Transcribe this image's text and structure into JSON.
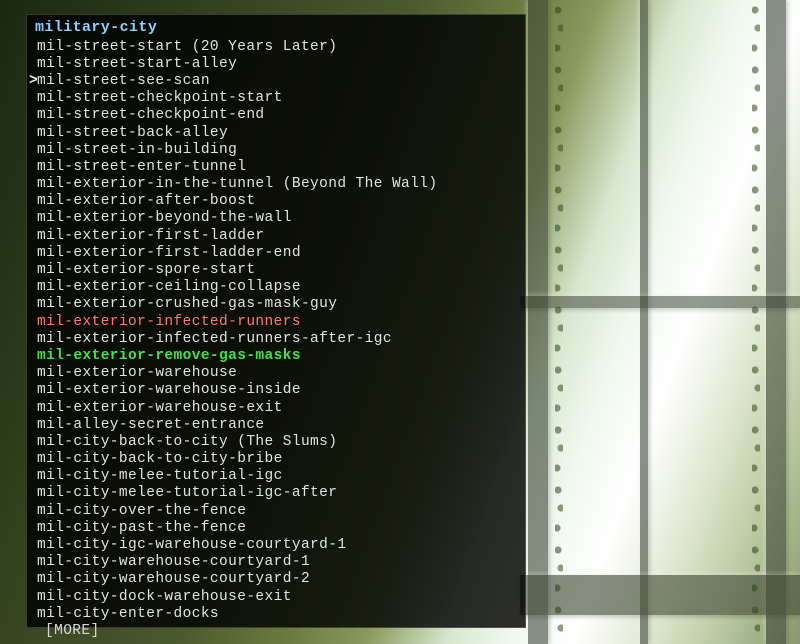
{
  "menu": {
    "title": "military-city",
    "items": [
      {
        "label": "mil-street-start (20 Years Later)",
        "color": "default",
        "selected": false
      },
      {
        "label": "mil-street-start-alley",
        "color": "default",
        "selected": false
      },
      {
        "label": "mil-street-see-scan",
        "color": "default",
        "selected": true
      },
      {
        "label": "mil-street-checkpoint-start",
        "color": "default",
        "selected": false
      },
      {
        "label": "mil-street-checkpoint-end",
        "color": "default",
        "selected": false
      },
      {
        "label": "mil-street-back-alley",
        "color": "default",
        "selected": false
      },
      {
        "label": "mil-street-in-building",
        "color": "default",
        "selected": false
      },
      {
        "label": "mil-street-enter-tunnel",
        "color": "default",
        "selected": false
      },
      {
        "label": "mil-exterior-in-the-tunnel (Beyond The Wall)",
        "color": "default",
        "selected": false
      },
      {
        "label": "mil-exterior-after-boost",
        "color": "default",
        "selected": false
      },
      {
        "label": "mil-exterior-beyond-the-wall",
        "color": "default",
        "selected": false
      },
      {
        "label": "mil-exterior-first-ladder",
        "color": "default",
        "selected": false
      },
      {
        "label": "mil-exterior-first-ladder-end",
        "color": "default",
        "selected": false
      },
      {
        "label": "mil-exterior-spore-start",
        "color": "default",
        "selected": false
      },
      {
        "label": "mil-exterior-ceiling-collapse",
        "color": "default",
        "selected": false
      },
      {
        "label": "mil-exterior-crushed-gas-mask-guy",
        "color": "default",
        "selected": false
      },
      {
        "label": "mil-exterior-infected-runners",
        "color": "red",
        "selected": false
      },
      {
        "label": "mil-exterior-infected-runners-after-igc",
        "color": "default",
        "selected": false
      },
      {
        "label": "mil-exterior-remove-gas-masks",
        "color": "green",
        "selected": false
      },
      {
        "label": "mil-exterior-warehouse",
        "color": "default",
        "selected": false
      },
      {
        "label": "mil-exterior-warehouse-inside",
        "color": "default",
        "selected": false
      },
      {
        "label": "mil-exterior-warehouse-exit",
        "color": "default",
        "selected": false
      },
      {
        "label": "mil-alley-secret-entrance",
        "color": "default",
        "selected": false
      },
      {
        "label": "mil-city-back-to-city (The Slums)",
        "color": "default",
        "selected": false
      },
      {
        "label": "mil-city-back-to-city-bribe",
        "color": "default",
        "selected": false
      },
      {
        "label": "mil-city-melee-tutorial-igc",
        "color": "default",
        "selected": false
      },
      {
        "label": "mil-city-melee-tutorial-igc-after",
        "color": "default",
        "selected": false
      },
      {
        "label": "mil-city-over-the-fence",
        "color": "default",
        "selected": false
      },
      {
        "label": "mil-city-past-the-fence",
        "color": "default",
        "selected": false
      },
      {
        "label": "mil-city-igc-warehouse-courtyard-1",
        "color": "default",
        "selected": false
      },
      {
        "label": "mil-city-warehouse-courtyard-1",
        "color": "default",
        "selected": false
      },
      {
        "label": "mil-city-warehouse-courtyard-2",
        "color": "default",
        "selected": false
      },
      {
        "label": "mil-city-dock-warehouse-exit",
        "color": "default",
        "selected": false
      },
      {
        "label": "mil-city-enter-docks",
        "color": "default",
        "selected": false
      }
    ],
    "more_label": "[MORE]",
    "cursor_glyph": ">"
  }
}
